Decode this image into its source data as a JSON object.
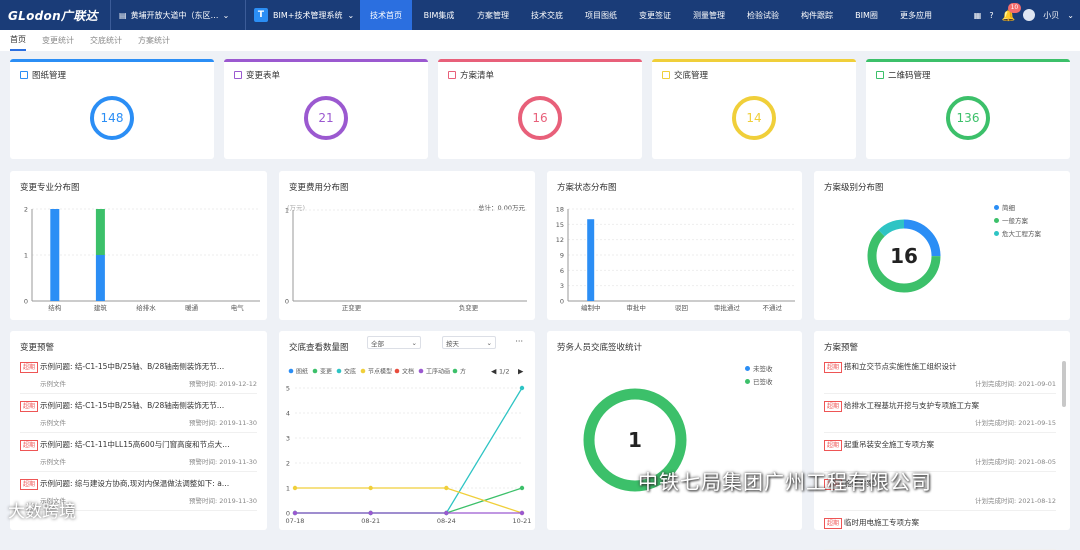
{
  "topbar": {
    "logo": "GLodon广联达",
    "project": "黄埔开放大道中（东区…",
    "system": "BIM+技术管理系统",
    "nav": [
      {
        "label": "技术首页",
        "active": true,
        "w": 52
      },
      {
        "label": "BIM集成",
        "w": 54
      },
      {
        "label": "方案管理",
        "w": 54
      },
      {
        "label": "技术交底",
        "w": 54
      },
      {
        "label": "项目图纸",
        "w": 54
      },
      {
        "label": "变更签证",
        "w": 54
      },
      {
        "label": "测量管理",
        "w": 54
      },
      {
        "label": "检验试验",
        "w": 54
      },
      {
        "label": "构件跟踪",
        "w": 54
      },
      {
        "label": "BIM圈",
        "w": 45
      },
      {
        "label": "更多应用",
        "w": 54
      }
    ],
    "badge": "10",
    "user": "小贝"
  },
  "subtabs": [
    {
      "label": "首页",
      "active": true
    },
    {
      "label": "变更统计"
    },
    {
      "label": "交底统计"
    },
    {
      "label": "方案统计"
    }
  ],
  "stats": [
    {
      "label": "图纸管理",
      "value": "148",
      "color": "#2b8ef5"
    },
    {
      "label": "变更表单",
      "value": "21",
      "color": "#9b59d0"
    },
    {
      "label": "方案清单",
      "value": "16",
      "color": "#e8607a"
    },
    {
      "label": "交底管理",
      "value": "14",
      "color": "#f0cf3a"
    },
    {
      "label": "二维码管理",
      "value": "136",
      "color": "#3cc06a"
    }
  ],
  "c1": {
    "title": "变更专业分布图"
  },
  "c2": {
    "title": "变更费用分布图",
    "unit": "(万元)",
    "total": "总计：0.00万元"
  },
  "c3": {
    "title": "方案状态分布图"
  },
  "c4": {
    "title": "方案级别分布图",
    "center": "16"
  },
  "w1": {
    "title": "变更预警"
  },
  "c5": {
    "title": "交底查看数量图",
    "sel1": "全部",
    "sel2": "按天",
    "page": "1/2",
    "more": "···"
  },
  "c6": {
    "title": "劳务人员交底签收统计",
    "center": "1"
  },
  "w2": {
    "title": "方案预警"
  },
  "chart_data": [
    {
      "type": "bar",
      "title": "变更专业分布图",
      "categories": [
        "结构",
        "建筑",
        "给排水",
        "暖通",
        "电气"
      ],
      "series": [
        {
          "values": [
            2,
            1,
            0,
            0,
            0
          ],
          "color": "#2b8ef5"
        },
        {
          "values": [
            0,
            1,
            0,
            0,
            0
          ],
          "color": "#3cc06a"
        }
      ],
      "ylim": [
        0,
        2
      ],
      "yticks": [
        0,
        1,
        2
      ]
    },
    {
      "type": "bar",
      "title": "变更费用分布图",
      "categories": [
        "正变更",
        "负变更"
      ],
      "values": [
        0,
        0
      ],
      "ylim": [
        0,
        1
      ],
      "yticks": [
        0,
        1
      ]
    },
    {
      "type": "bar",
      "title": "方案状态分布图",
      "categories": [
        "编制中",
        "审批中",
        "驳回",
        "审批通过",
        "不通过"
      ],
      "values": [
        16,
        0,
        0,
        0,
        0
      ],
      "ylim": [
        0,
        18
      ],
      "yticks": [
        0,
        3,
        6,
        9,
        12,
        15,
        18
      ]
    },
    {
      "type": "pie",
      "title": "方案级别分布图",
      "labels": [
        "简细",
        "一般方案",
        "危大工程方案"
      ],
      "values": [
        4,
        10,
        2
      ],
      "colors": [
        "#2b8ef5",
        "#3cc06a",
        "#2ec4c4"
      ]
    },
    {
      "type": "line",
      "title": "交底查看数量图",
      "x": [
        "07-18",
        "08-21",
        "08-24",
        "10-21"
      ],
      "ylim": [
        0,
        5
      ],
      "yticks": [
        0,
        1,
        2,
        3,
        4,
        5
      ],
      "legend": [
        "图纸",
        "变更",
        "交底",
        "节点模型",
        "文档",
        "工序动画",
        "方"
      ],
      "legend_colors": [
        "#2b8ef5",
        "#3cc06a",
        "#2ec4c4",
        "#f0cf3a",
        "#e84c3d",
        "#9b59d0",
        "#3cc06a"
      ],
      "series": [
        {
          "name": "交底",
          "values": [
            0,
            0,
            0,
            5
          ],
          "color": "#2ec4c4"
        },
        {
          "name": "变更",
          "values": [
            0,
            0,
            0,
            1
          ],
          "color": "#3cc06a"
        },
        {
          "name": "节点模型",
          "values": [
            1,
            1,
            1,
            0
          ],
          "color": "#f0cf3a"
        },
        {
          "name": "工序动画",
          "values": [
            0,
            0,
            0,
            0
          ],
          "color": "#9b59d0"
        }
      ]
    },
    {
      "type": "pie",
      "title": "劳务人员交底签收统计",
      "labels": [
        "未签收",
        "已签收"
      ],
      "values": [
        0,
        1
      ],
      "colors": [
        "#2b8ef5",
        "#3cc06a"
      ]
    }
  ],
  "warn1": [
    {
      "tag": "超期",
      "text": "示例问题: 结-C1-15中B/25轴、B/28轴南侧装饰无节…",
      "sub": "示例文件",
      "date": "预警时间: 2019-12-12"
    },
    {
      "tag": "超期",
      "text": "示例问题: 结-C1-15中B/25轴、B/28轴南侧装饰无节…",
      "sub": "示例文件",
      "date": "预警时间: 2019-11-30"
    },
    {
      "tag": "超期",
      "text": "示例问题: 结-C1-11中LL15高600与门窗高度和节点大…",
      "sub": "示例文件",
      "date": "预警时间: 2019-11-30"
    },
    {
      "tag": "超期",
      "text": "示例问题: 综与建设方协商,现对内保温做法调整如下: a…",
      "sub": "示例文件",
      "date": "预警时间: 2019-11-30"
    }
  ],
  "warn2": [
    {
      "tag": "超期",
      "text": "搭和立交节点实施性施工组织设计",
      "date": "计划完成时间: 2021-09-01"
    },
    {
      "tag": "超期",
      "text": "给排水工程基坑开挖与支护专项施工方案",
      "date": "计划完成时间: 2021-09-15"
    },
    {
      "tag": "超期",
      "text": "起重吊装安全施工专项方案",
      "date": "计划完成时间: 2021-08-05"
    },
    {
      "tag": "超期",
      "text": "施工方案",
      "date": "计划完成时间: 2021-08-12"
    },
    {
      "tag": "超期",
      "text": "临时用电施工专项方案",
      "date": ""
    }
  ],
  "watermark": "中铁七局集团广州工程有限公司",
  "watermark2": "大数跨境"
}
